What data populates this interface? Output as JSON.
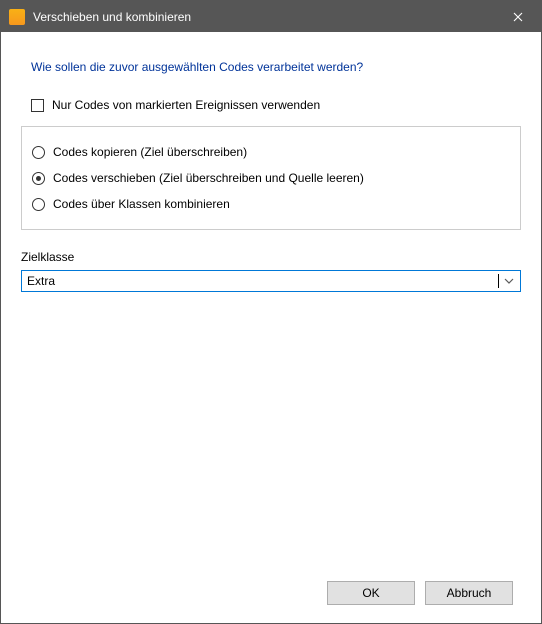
{
  "titlebar": {
    "title": "Verschieben und kombinieren"
  },
  "question": "Wie sollen die zuvor ausgewählten Codes verarbeitet werden?",
  "checkbox": {
    "label": "Nur Codes von markierten Ereignissen verwenden",
    "checked": false
  },
  "radios": {
    "selected_index": 1,
    "options": [
      "Codes kopieren (Ziel überschreiben)",
      "Codes verschieben (Ziel überschreiben und Quelle leeren)",
      "Codes über Klassen kombinieren"
    ]
  },
  "target": {
    "label": "Zielklasse",
    "value": "Extra"
  },
  "buttons": {
    "ok": "OK",
    "cancel": "Abbruch"
  }
}
